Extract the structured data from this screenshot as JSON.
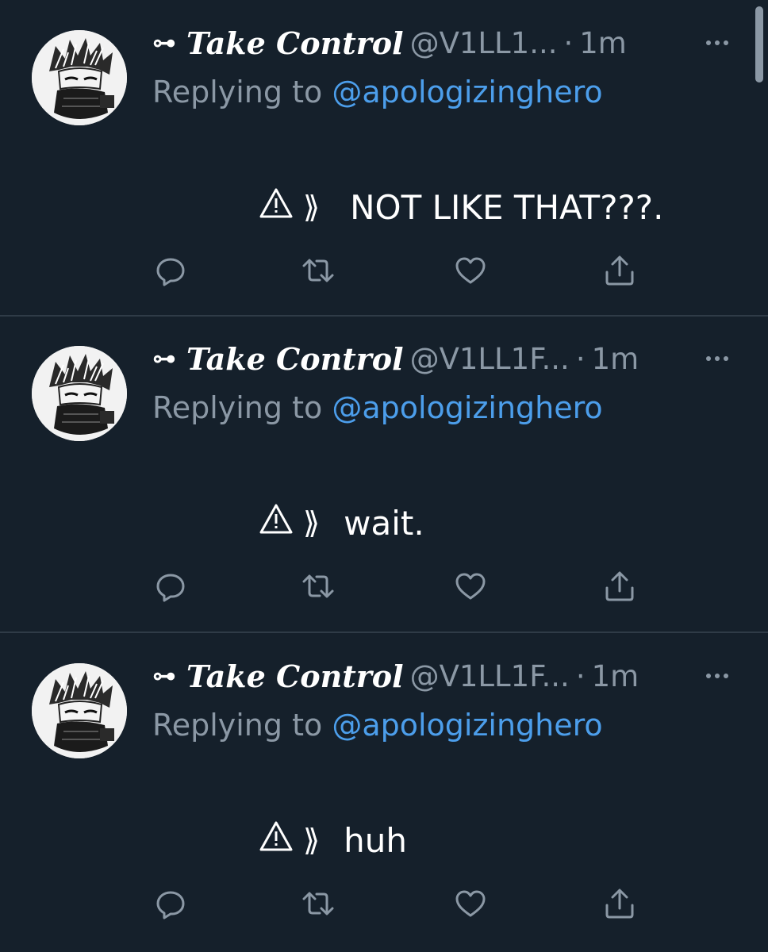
{
  "tweets": [
    {
      "name_glyph": "⊶",
      "display_name": "Take Control",
      "handle": "@V1LL1...",
      "dot": "·",
      "time": "1m",
      "reply_prefix": "Replying to ",
      "reply_handle": "@apologizinghero",
      "content_prefix": "⟫",
      "content_text": "NOT LIKE THAT???."
    },
    {
      "name_glyph": "⊶",
      "display_name": "Take Control",
      "handle": "@V1LL1F...",
      "dot": "·",
      "time": "1m",
      "reply_prefix": "Replying to ",
      "reply_handle": "@apologizinghero",
      "content_prefix": "⟫",
      "content_text": "wait."
    },
    {
      "name_glyph": "⊶",
      "display_name": "Take Control",
      "handle": "@V1LL1F...",
      "dot": "·",
      "time": "1m",
      "reply_prefix": "Replying to ",
      "reply_handle": "@apologizinghero",
      "content_prefix": "⟫",
      "content_text": "huh"
    }
  ],
  "icons": {
    "warning": "warning-icon",
    "reply": "reply-icon",
    "retweet": "retweet-icon",
    "like": "heart-icon",
    "share": "share-icon",
    "more": "more-icon"
  },
  "colors": {
    "background": "#15202b",
    "divider": "#2f3b47",
    "secondary_text": "#8b98a5",
    "link": "#4c9eeb",
    "primary_text": "#ffffff"
  }
}
